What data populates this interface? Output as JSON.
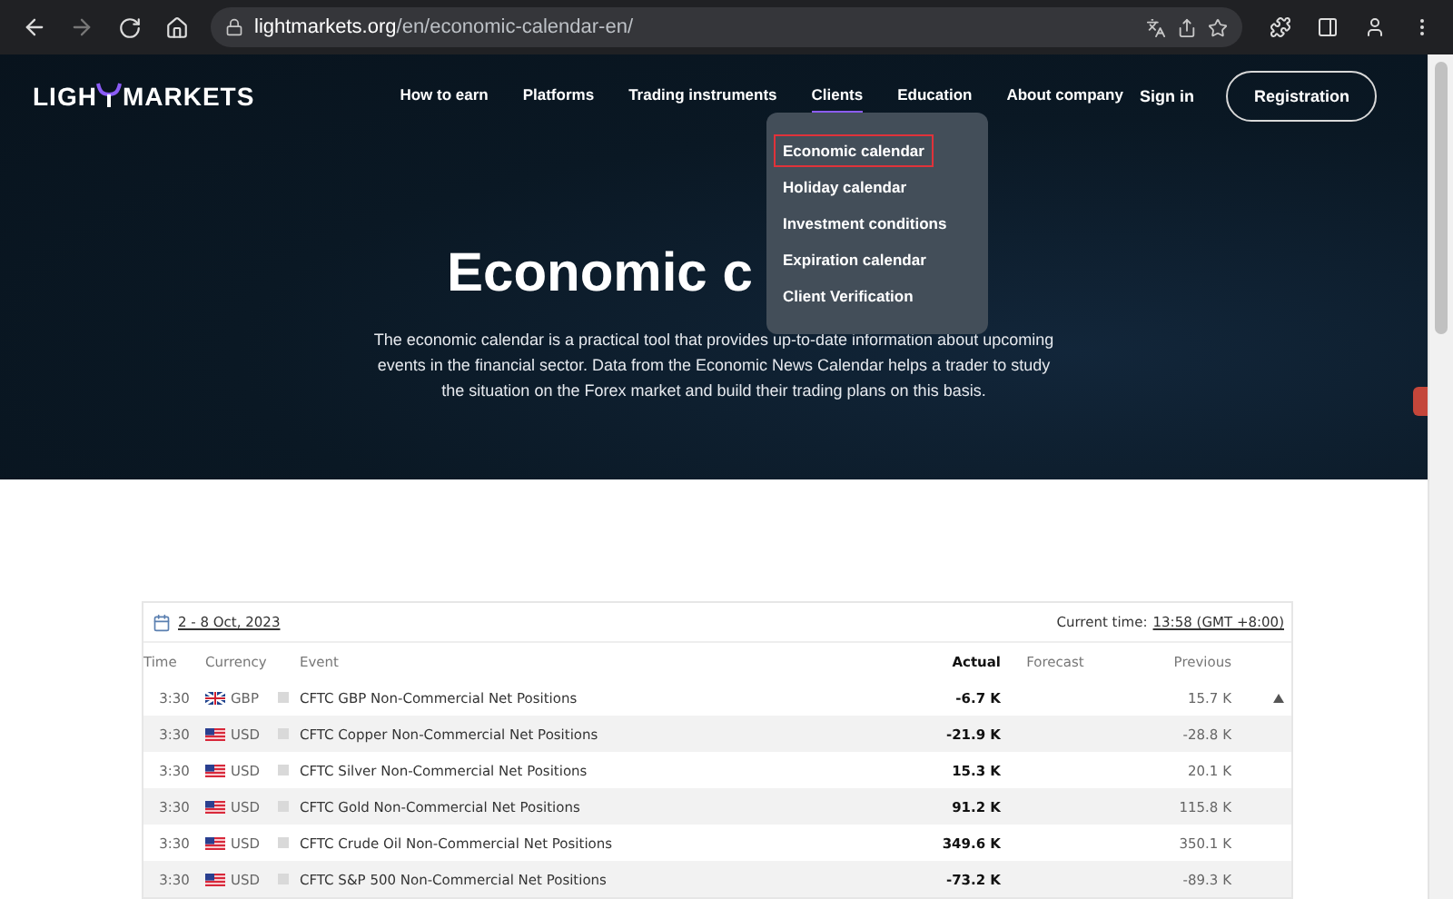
{
  "browser": {
    "url_host": "lightmarkets.org",
    "url_path": "/en/economic-calendar-en/"
  },
  "header": {
    "logo_left": "LIGH",
    "logo_right": "MARKETS",
    "nav": [
      {
        "label": "How to earn",
        "selected": false
      },
      {
        "label": "Platforms",
        "selected": false
      },
      {
        "label": "Trading instruments",
        "selected": false
      },
      {
        "label": "Clients",
        "selected": true
      },
      {
        "label": "Education",
        "selected": false
      },
      {
        "label": "About company",
        "selected": false
      }
    ],
    "sign_in": "Sign in",
    "registration": "Registration"
  },
  "dropdown": [
    {
      "label": "Economic calendar",
      "selected": true
    },
    {
      "label": "Holiday calendar",
      "selected": false
    },
    {
      "label": "Investment conditions",
      "selected": false
    },
    {
      "label": "Expiration calendar",
      "selected": false
    },
    {
      "label": "Client Verification",
      "selected": false
    }
  ],
  "hero": {
    "title": "Economic c",
    "description": "The economic calendar is a practical tool that provides up-to-date information about upcoming events in the financial sector. Data from the Economic News Calendar helps a trader to study the situation on the Forex market and build their trading plans on this basis."
  },
  "calendar": {
    "date_range": "2 - 8 Oct, 2023",
    "current_time_label": "Current time:",
    "current_time": "13:58 (GMT +8:00)",
    "columns": [
      "Time",
      "Currency",
      "Event",
      "Actual",
      "Forecast",
      "Previous"
    ],
    "rows": [
      {
        "time": "3:30",
        "kind": "gb",
        "currency": "GBP",
        "event": "CFTC GBP Non-Commercial Net Positions",
        "actual": "-6.7 K",
        "previous": "15.7 K"
      },
      {
        "time": "3:30",
        "kind": "us",
        "currency": "USD",
        "event": "CFTC Copper Non-Commercial Net Positions",
        "actual": "-21.9 K",
        "previous": "-28.8 K"
      },
      {
        "time": "3:30",
        "kind": "us",
        "currency": "USD",
        "event": "CFTC Silver Non-Commercial Net Positions",
        "actual": "15.3 K",
        "previous": "20.1 K"
      },
      {
        "time": "3:30",
        "kind": "us",
        "currency": "USD",
        "event": "CFTC Gold Non-Commercial Net Positions",
        "actual": "91.2 K",
        "previous": "115.8 K"
      },
      {
        "time": "3:30",
        "kind": "us",
        "currency": "USD",
        "event": "CFTC Crude Oil Non-Commercial Net Positions",
        "actual": "349.6 K",
        "previous": "350.1 K"
      },
      {
        "time": "3:30",
        "kind": "us",
        "currency": "USD",
        "event": "CFTC S&P 500 Non-Commercial Net Positions",
        "actual": "-73.2 K",
        "previous": "-89.3 K"
      }
    ]
  }
}
